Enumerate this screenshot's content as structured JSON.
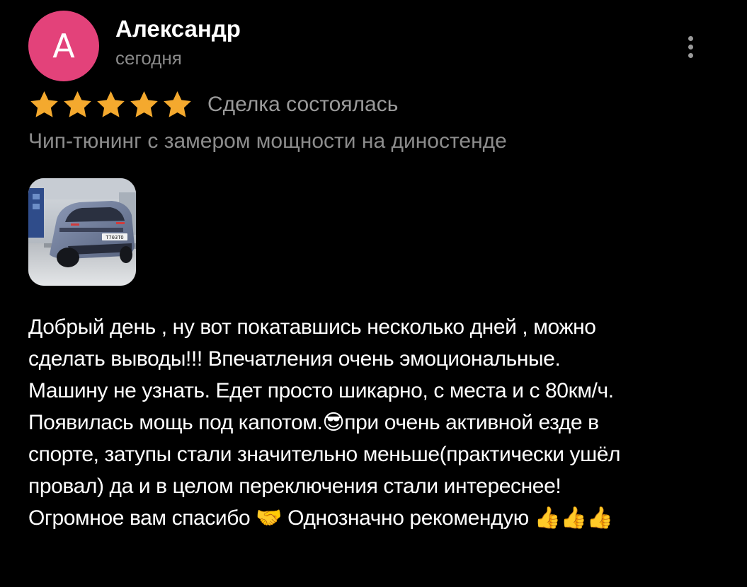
{
  "review": {
    "author": {
      "initial": "А",
      "name": "Александр",
      "date": "сегодня",
      "avatar_color": "#e3427a"
    },
    "menu_icon": "more-vertical-icon",
    "rating": {
      "stars": 5,
      "max_stars": 5,
      "star_color": "#f4a92e",
      "status": "Сделка состоялась"
    },
    "service": "Чип-тюнинг с замером мощности на диностенде",
    "photo": {
      "plate_text": "Т703ТО"
    },
    "text_lines": [
      "Добрый день , ну вот покатавшись несколько дней , можно",
      "сделать выводы!!! Впечатления очень эмоциональные.",
      "Машину не узнать. Едет просто шикарно, с места и с 80км/ч.",
      "Появилась мощь под капотом.😎при очень активной езде в",
      "спорте, затупы стали значительно меньше(практически ушёл",
      "провал) да и в целом переключения стали интереснее!",
      "Огромное вам спасибо 🤝 Однозначно рекомендую 👍👍👍"
    ]
  }
}
